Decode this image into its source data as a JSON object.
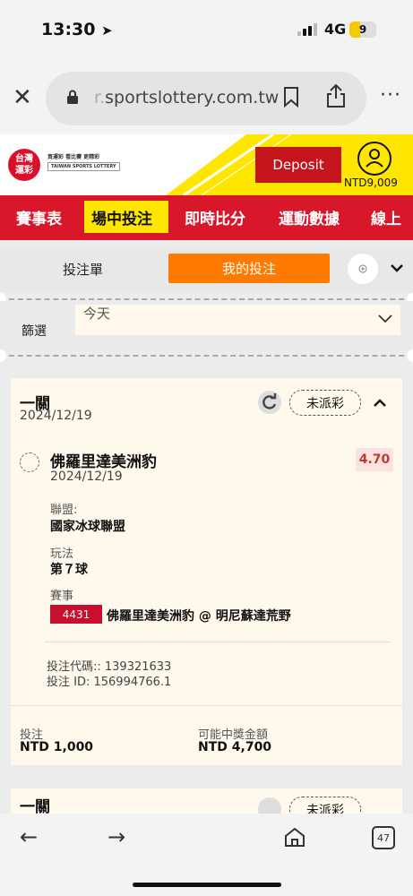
{
  "status": {
    "time": "13:30",
    "network": "4G",
    "battery": "9"
  },
  "browser": {
    "url_partial": "sportslottery.com.tw",
    "tab_count": "47"
  },
  "site": {
    "logo_text": "台灣運彩",
    "logo_caption_1": "買運彩 看比賽 更精彩",
    "logo_caption_2": "TAIWAN SPORTS LOTTERY",
    "deposit_label": "Deposit",
    "balance": "NTD9,009"
  },
  "nav": {
    "items": [
      "賽事表",
      "場中投注",
      "即時比分",
      "運動數據",
      "線上"
    ],
    "active_index": 1
  },
  "tabs": {
    "betslip": "投注單",
    "my_bets": "我的投注"
  },
  "filter": {
    "label": "篩選",
    "value": "今天"
  },
  "bet": {
    "type": "一關",
    "date": "2024/12/19",
    "status": "未派彩",
    "selection": {
      "team": "佛羅里達美洲豹",
      "date": "2024/12/19",
      "odds": "4.70",
      "league_label": "聯盟:",
      "league": "國家冰球聯盟",
      "market_label": "玩法",
      "market": "第７球",
      "event_label": "賽事",
      "event_code": "4431",
      "event_name": "佛羅里達美洲豹 @ 明尼蘇達荒野"
    },
    "bet_code": "投注代碼:: 139321633",
    "bet_id": "投注 ID: 156994766.1",
    "stake_label": "投注",
    "stake": "NTD 1,000",
    "payout_label": "可能中獎金額",
    "payout": "NTD 4,700"
  },
  "bet2": {
    "type": "一關",
    "status": "未派彩"
  },
  "colors": {
    "brand_red": "#d8182a",
    "accent_orange": "#ff7a00",
    "highlight_yellow": "#ffe600",
    "odds_red": "#c0392b"
  }
}
